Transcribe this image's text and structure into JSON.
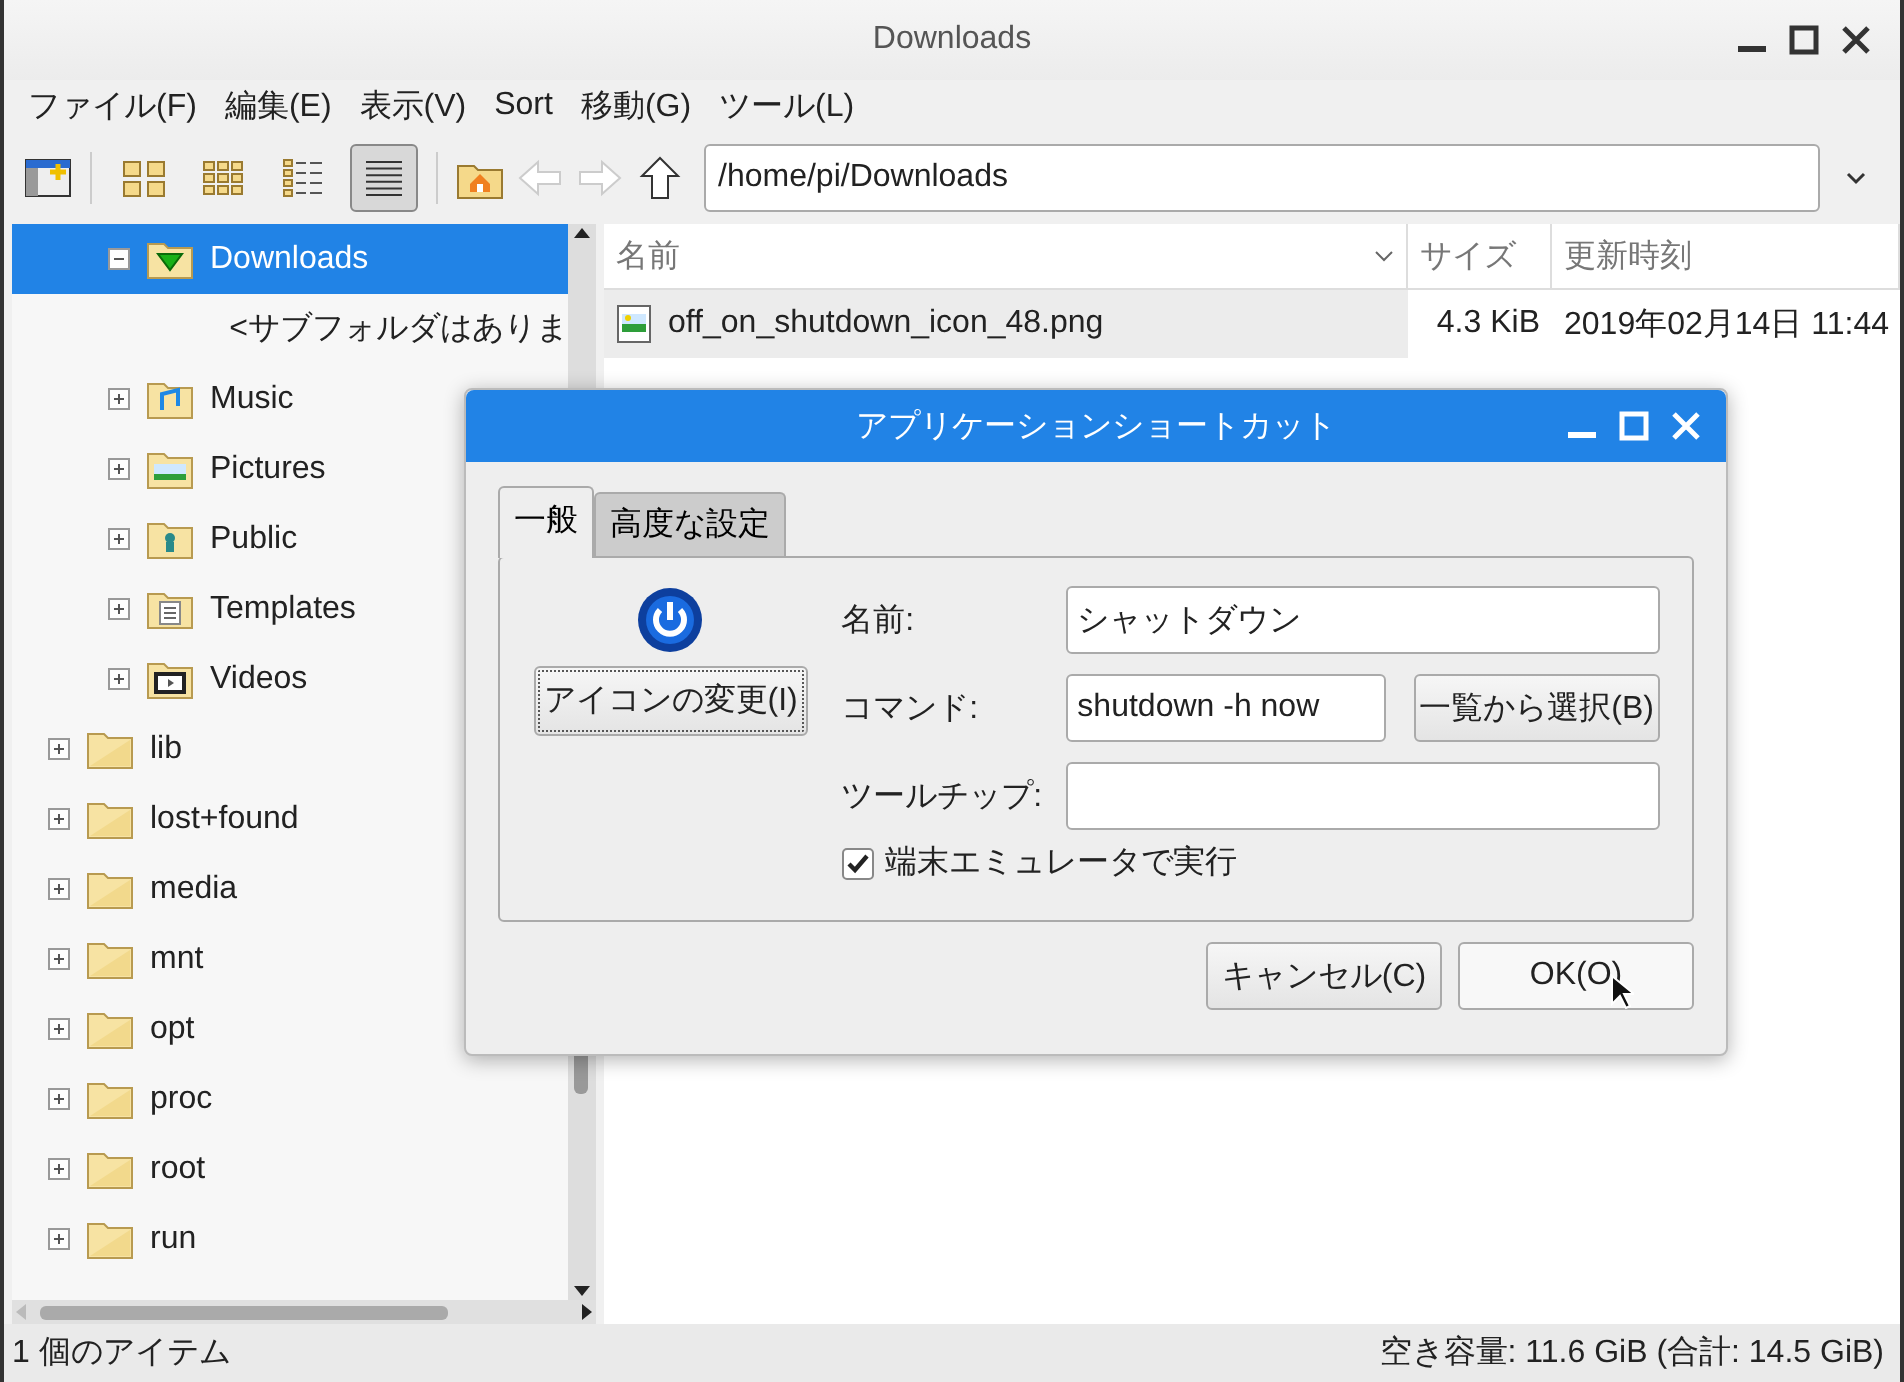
{
  "window": {
    "title": "Downloads"
  },
  "menu": [
    "ファイル(F)",
    "編集(E)",
    "表示(V)",
    "Sort",
    "移動(G)",
    "ツール(L)"
  ],
  "toolbar": {
    "view_modes": [
      {
        "kind": "icons",
        "selected": false
      },
      {
        "kind": "thumbnails",
        "selected": false
      },
      {
        "kind": "compact",
        "selected": false
      },
      {
        "kind": "details",
        "selected": true
      }
    ],
    "back_disabled": true,
    "forward_disabled": true,
    "path": "/home/pi/Downloads"
  },
  "tree": {
    "items": [
      {
        "children": [
          {
            "label": "Downloads",
            "kind": "downloads",
            "expanded": true,
            "selected": true,
            "children": [
              {
                "label": "<サブフォルダはありま",
                "kind": "placeholder"
              }
            ]
          },
          {
            "label": "Music",
            "kind": "music",
            "expanded": false,
            "selected": false
          },
          {
            "label": "Pictures",
            "kind": "pictures",
            "expanded": false,
            "selected": false
          },
          {
            "label": "Public",
            "kind": "public",
            "expanded": false,
            "selected": false
          },
          {
            "label": "Templates",
            "kind": "templates",
            "expanded": false,
            "selected": false
          },
          {
            "label": "Videos",
            "kind": "videos",
            "expanded": false,
            "selected": false
          }
        ]
      },
      {
        "label": "lib",
        "kind": "folder",
        "expanded": false,
        "selected": false
      },
      {
        "label": "lost+found",
        "kind": "folder",
        "expanded": false,
        "selected": false
      },
      {
        "label": "media",
        "kind": "folder",
        "expanded": false,
        "selected": false
      },
      {
        "label": "mnt",
        "kind": "folder",
        "expanded": false,
        "selected": false
      },
      {
        "label": "opt",
        "kind": "folder",
        "expanded": false,
        "selected": false
      },
      {
        "label": "proc",
        "kind": "folder",
        "expanded": false,
        "selected": false
      },
      {
        "label": "root",
        "kind": "folder",
        "expanded": false,
        "selected": false
      },
      {
        "label": "run",
        "kind": "folder",
        "expanded": false,
        "selected": false
      }
    ]
  },
  "files": {
    "columns": [
      "名前",
      "サイズ",
      "更新時刻"
    ],
    "rows": [
      {
        "name": "off_on_shutdown_icon_48.png",
        "size": "4.3 KiB",
        "modified": "2019年02月14日 11:44",
        "selected": true
      }
    ]
  },
  "status_bar": {
    "items": "1 個のアイテム",
    "space": "空き容量: 11.6 GiB (合計: 14.5 GiB)"
  },
  "dialog": {
    "title": "アプリケーションショートカット",
    "tabs": [
      {
        "label": "一般",
        "selected": true
      },
      {
        "label": "高度な設定",
        "selected": false
      }
    ],
    "change_icon": "アイコンの変更(I)",
    "fields": [
      {
        "label": "名前:",
        "value": "シャットダウン"
      },
      {
        "label": "コマンド:",
        "value": "shutdown -h now",
        "button": "一覧から選択(B)"
      },
      {
        "label": "ツールチップ:"
      }
    ],
    "terminal": {
      "label": "端末エミュレータで実行",
      "checked": true
    },
    "buttons": [
      "キャンセル(C)",
      "OK(O)"
    ]
  }
}
